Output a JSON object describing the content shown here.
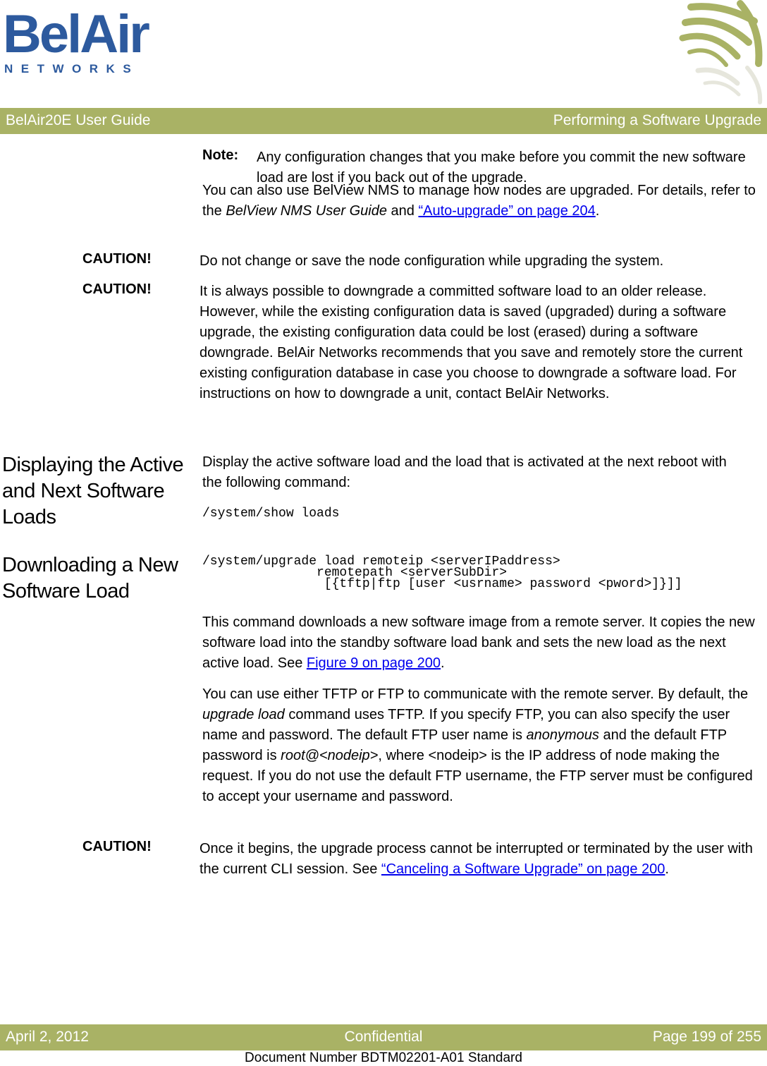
{
  "logo": {
    "wordmark": "BelAir",
    "sub": "NETWORKS"
  },
  "header": {
    "left": "BelAir20E User Guide",
    "right": "Performing a Software Upgrade"
  },
  "note": {
    "label": "Note:",
    "text": "Any configuration changes that you make before you commit the new software load are lost if you back out of the upgrade."
  },
  "belview_para": {
    "pre": "You can also use BelView NMS to manage how nodes are upgraded. For details, refer to the ",
    "italic": "BelView NMS User Guide",
    "mid": " and ",
    "link": "“Auto-upgrade” on page 204",
    "post": "."
  },
  "caution1": {
    "label": "CAUTION!",
    "text": "Do not change or save the node configuration while upgrading the system."
  },
  "caution2": {
    "label": "CAUTION!",
    "text": "It is always possible to downgrade a committed software load to an older release. However, while the existing configuration data is saved (upgraded) during a software upgrade, the existing configuration data could be lost (erased) during a software downgrade. BelAir Networks recommends that you save and remotely store the current existing configuration database in case you choose to downgrade a software load. For instructions on how to downgrade a unit, contact BelAir Networks."
  },
  "section1": {
    "heading": "Displaying the Active and Next Software Loads",
    "text": "Display the active software load and the load that is activated at the next reboot with the following command:",
    "code": "/system/show loads"
  },
  "section2": {
    "heading": "Downloading a New Software Load",
    "code_lines": [
      "/system/upgrade load remoteip <serverIPaddress>",
      "               remotepath <serverSubDir>",
      "                [{tftp|ftp [user <usrname> password <pword>]}]]"
    ],
    "para1": {
      "pre": "This command downloads a new software image from a remote server. It copies the new software load into the standby software load bank and sets the new load as the next active load. See ",
      "link": "Figure 9 on page 200",
      "post": "."
    },
    "para2": {
      "t1": "You can use either TFTP or FTP to communicate with the remote server. By default, the ",
      "i1": "upgrade load",
      "t2": " command uses TFTP. If you specify FTP, you can also specify the user name and password. The default FTP user name is ",
      "i2": "anonymous",
      "t3": " and the default FTP password is ",
      "i3": "root@<nodeip>",
      "t4": ", where <nodeip> is the IP address of node making the request. If you do not use the default FTP username, the FTP server must be configured to accept your username and password."
    }
  },
  "caution3": {
    "label": "CAUTION!",
    "pre": "Once it begins, the upgrade process cannot be interrupted or terminated by the user with the current CLI session. See ",
    "link": "“Canceling a Software Upgrade” on page 200",
    "post": "."
  },
  "footer": {
    "date": "April 2, 2012",
    "center": "Confidential",
    "page": "Page 199 of 255",
    "docnum": "Document Number BDTM02201-A01 Standard"
  }
}
